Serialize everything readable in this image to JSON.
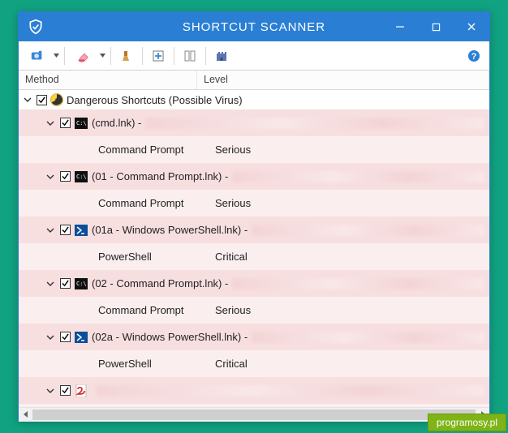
{
  "window": {
    "title": "SHORTCUT SCANNER"
  },
  "columns": {
    "method": "Method",
    "level": "Level"
  },
  "root": {
    "label": "Dangerous Shortcuts (Possible Virus)"
  },
  "items": [
    {
      "filename": "(cmd.lnk) -",
      "method": "Command Prompt",
      "level": "Serious",
      "icon": "cmd"
    },
    {
      "filename": "(01 - Command Prompt.lnk) -",
      "method": "Command Prompt",
      "level": "Serious",
      "icon": "cmd"
    },
    {
      "filename": "(01a - Windows PowerShell.lnk) -",
      "method": "PowerShell",
      "level": "Critical",
      "icon": "ps"
    },
    {
      "filename": "(02 - Command Prompt.lnk) -",
      "method": "Command Prompt",
      "level": "Serious",
      "icon": "cmd"
    },
    {
      "filename": "(02a - Windows PowerShell.lnk) -",
      "method": "PowerShell",
      "level": "Critical",
      "icon": "ps"
    },
    {
      "filename": "",
      "method": "",
      "level": "",
      "icon": "pdf"
    }
  ],
  "watermark": "programosy.pl"
}
